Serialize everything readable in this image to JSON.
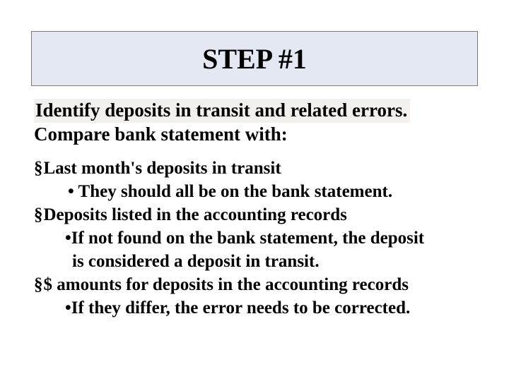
{
  "title": "STEP #1",
  "lead": {
    "line1": "Identify deposits in transit and related errors.",
    "line2": "Compare bank statement with:"
  },
  "bullets": {
    "b1a": "Last month's deposits in transit",
    "b1a_sub": "• They should all be on the bank statement.",
    "b1b": "Deposits listed in the accounting records",
    "b1b_sub_l1": "•If not found on the bank statement, the deposit",
    "b1b_sub_l2": "is considered a deposit in transit.",
    "b1c": "$ amounts for deposits in the accounting records",
    "b1c_sub": "•If they differ, the error needs to be corrected."
  }
}
